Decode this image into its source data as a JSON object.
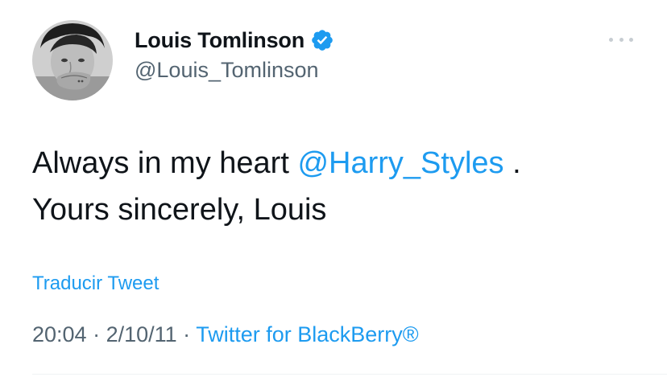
{
  "author": {
    "display_name": "Louis Tomlinson",
    "handle": "@Louis_Tomlinson",
    "verified": true,
    "verified_color": "#1d9bf0",
    "avatar_icon": "profile-photo"
  },
  "more_icon": "ellipsis-icon",
  "tweet": {
    "line1_prefix": "Always in my heart ",
    "mention": "@Harry_Styles",
    "line1_suffix": " .",
    "line2": "Yours sincerely, Louis"
  },
  "translate_label": "Traducir Tweet",
  "meta": {
    "time": "20:04",
    "separator1": " · ",
    "date": "2/10/11",
    "separator2": " · ",
    "source": "Twitter for BlackBerry®"
  },
  "colors": {
    "link": "#1d9bf0",
    "text": "#0f1419",
    "secondary": "#536471"
  }
}
